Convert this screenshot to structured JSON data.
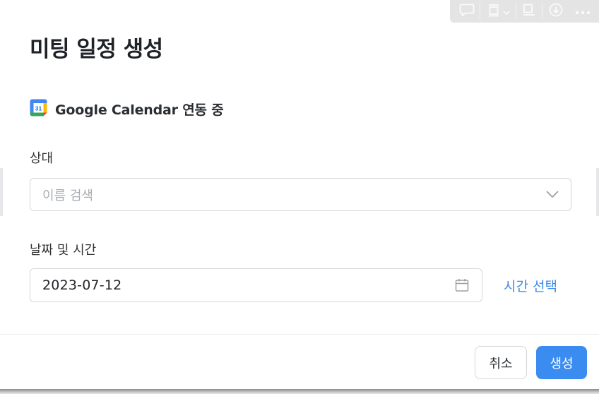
{
  "dialog": {
    "title": "미팅 일정 생성"
  },
  "calendar_sync": {
    "icon": "google-calendar-icon",
    "icon_day": "31",
    "label": "Google Calendar 연동 중"
  },
  "counterpart": {
    "label": "상대",
    "placeholder": "이름 검색",
    "value": ""
  },
  "datetime": {
    "label": "날짜 및 시간",
    "date_value": "2023-07-12",
    "time_select_label": "시간 선택"
  },
  "footer": {
    "cancel_label": "취소",
    "create_label": "생성"
  },
  "toolbar": {
    "icons": [
      "comment-icon",
      "frame-icon",
      "chevron-down-icon",
      "present-icon",
      "download-icon",
      "more-icon"
    ]
  },
  "colors": {
    "accent": "#3b8cf0",
    "link": "#3b8be8",
    "border": "#d3d6da",
    "placeholder": "#a8adb3"
  }
}
